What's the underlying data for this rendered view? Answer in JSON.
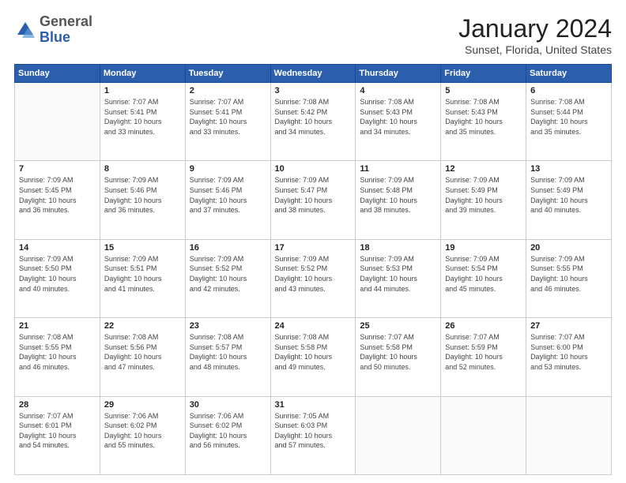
{
  "header": {
    "logo": {
      "general": "General",
      "blue": "Blue"
    },
    "title": "January 2024",
    "location": "Sunset, Florida, United States"
  },
  "calendar": {
    "headers": [
      "Sunday",
      "Monday",
      "Tuesday",
      "Wednesday",
      "Thursday",
      "Friday",
      "Saturday"
    ],
    "weeks": [
      [
        {
          "day": "",
          "info": ""
        },
        {
          "day": "1",
          "info": "Sunrise: 7:07 AM\nSunset: 5:41 PM\nDaylight: 10 hours\nand 33 minutes."
        },
        {
          "day": "2",
          "info": "Sunrise: 7:07 AM\nSunset: 5:41 PM\nDaylight: 10 hours\nand 33 minutes."
        },
        {
          "day": "3",
          "info": "Sunrise: 7:08 AM\nSunset: 5:42 PM\nDaylight: 10 hours\nand 34 minutes."
        },
        {
          "day": "4",
          "info": "Sunrise: 7:08 AM\nSunset: 5:43 PM\nDaylight: 10 hours\nand 34 minutes."
        },
        {
          "day": "5",
          "info": "Sunrise: 7:08 AM\nSunset: 5:43 PM\nDaylight: 10 hours\nand 35 minutes."
        },
        {
          "day": "6",
          "info": "Sunrise: 7:08 AM\nSunset: 5:44 PM\nDaylight: 10 hours\nand 35 minutes."
        }
      ],
      [
        {
          "day": "7",
          "info": "Sunrise: 7:09 AM\nSunset: 5:45 PM\nDaylight: 10 hours\nand 36 minutes."
        },
        {
          "day": "8",
          "info": "Sunrise: 7:09 AM\nSunset: 5:46 PM\nDaylight: 10 hours\nand 36 minutes."
        },
        {
          "day": "9",
          "info": "Sunrise: 7:09 AM\nSunset: 5:46 PM\nDaylight: 10 hours\nand 37 minutes."
        },
        {
          "day": "10",
          "info": "Sunrise: 7:09 AM\nSunset: 5:47 PM\nDaylight: 10 hours\nand 38 minutes."
        },
        {
          "day": "11",
          "info": "Sunrise: 7:09 AM\nSunset: 5:48 PM\nDaylight: 10 hours\nand 38 minutes."
        },
        {
          "day": "12",
          "info": "Sunrise: 7:09 AM\nSunset: 5:49 PM\nDaylight: 10 hours\nand 39 minutes."
        },
        {
          "day": "13",
          "info": "Sunrise: 7:09 AM\nSunset: 5:49 PM\nDaylight: 10 hours\nand 40 minutes."
        }
      ],
      [
        {
          "day": "14",
          "info": "Sunrise: 7:09 AM\nSunset: 5:50 PM\nDaylight: 10 hours\nand 40 minutes."
        },
        {
          "day": "15",
          "info": "Sunrise: 7:09 AM\nSunset: 5:51 PM\nDaylight: 10 hours\nand 41 minutes."
        },
        {
          "day": "16",
          "info": "Sunrise: 7:09 AM\nSunset: 5:52 PM\nDaylight: 10 hours\nand 42 minutes."
        },
        {
          "day": "17",
          "info": "Sunrise: 7:09 AM\nSunset: 5:52 PM\nDaylight: 10 hours\nand 43 minutes."
        },
        {
          "day": "18",
          "info": "Sunrise: 7:09 AM\nSunset: 5:53 PM\nDaylight: 10 hours\nand 44 minutes."
        },
        {
          "day": "19",
          "info": "Sunrise: 7:09 AM\nSunset: 5:54 PM\nDaylight: 10 hours\nand 45 minutes."
        },
        {
          "day": "20",
          "info": "Sunrise: 7:09 AM\nSunset: 5:55 PM\nDaylight: 10 hours\nand 46 minutes."
        }
      ],
      [
        {
          "day": "21",
          "info": "Sunrise: 7:08 AM\nSunset: 5:55 PM\nDaylight: 10 hours\nand 46 minutes."
        },
        {
          "day": "22",
          "info": "Sunrise: 7:08 AM\nSunset: 5:56 PM\nDaylight: 10 hours\nand 47 minutes."
        },
        {
          "day": "23",
          "info": "Sunrise: 7:08 AM\nSunset: 5:57 PM\nDaylight: 10 hours\nand 48 minutes."
        },
        {
          "day": "24",
          "info": "Sunrise: 7:08 AM\nSunset: 5:58 PM\nDaylight: 10 hours\nand 49 minutes."
        },
        {
          "day": "25",
          "info": "Sunrise: 7:07 AM\nSunset: 5:58 PM\nDaylight: 10 hours\nand 50 minutes."
        },
        {
          "day": "26",
          "info": "Sunrise: 7:07 AM\nSunset: 5:59 PM\nDaylight: 10 hours\nand 52 minutes."
        },
        {
          "day": "27",
          "info": "Sunrise: 7:07 AM\nSunset: 6:00 PM\nDaylight: 10 hours\nand 53 minutes."
        }
      ],
      [
        {
          "day": "28",
          "info": "Sunrise: 7:07 AM\nSunset: 6:01 PM\nDaylight: 10 hours\nand 54 minutes."
        },
        {
          "day": "29",
          "info": "Sunrise: 7:06 AM\nSunset: 6:02 PM\nDaylight: 10 hours\nand 55 minutes."
        },
        {
          "day": "30",
          "info": "Sunrise: 7:06 AM\nSunset: 6:02 PM\nDaylight: 10 hours\nand 56 minutes."
        },
        {
          "day": "31",
          "info": "Sunrise: 7:05 AM\nSunset: 6:03 PM\nDaylight: 10 hours\nand 57 minutes."
        },
        {
          "day": "",
          "info": ""
        },
        {
          "day": "",
          "info": ""
        },
        {
          "day": "",
          "info": ""
        }
      ]
    ]
  }
}
